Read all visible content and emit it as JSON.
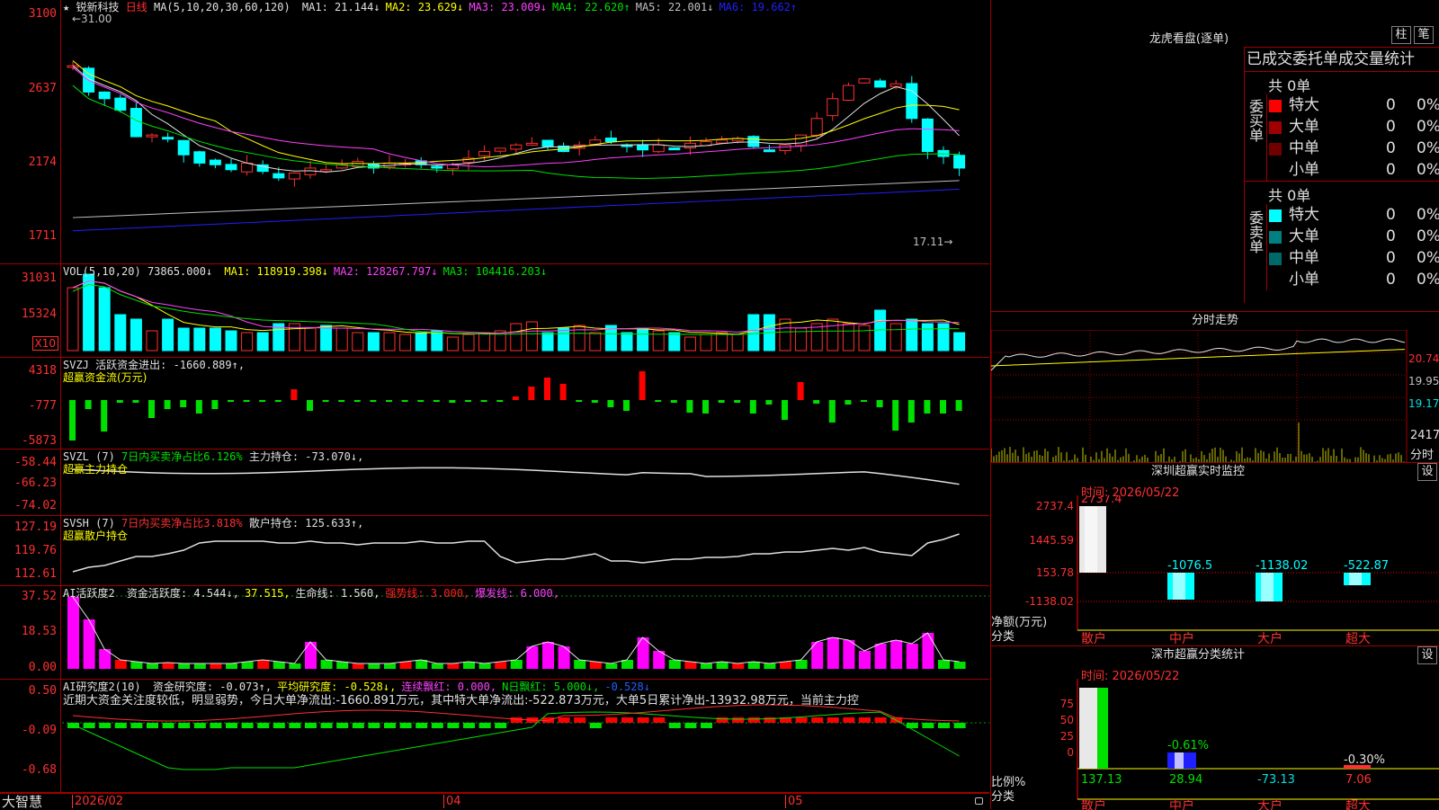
{
  "stock": {
    "star": "★",
    "name": "锐新科技",
    "period": "日线"
  },
  "main": {
    "ma_label": "MA(5,10,20,30,60,120)",
    "ma": [
      {
        "t": "MA1: 21.144↓",
        "c": "#e0e0e0"
      },
      {
        "t": "MA2: 23.629↓",
        "c": "#ffff00"
      },
      {
        "t": "MA3: 23.009↓",
        "c": "#ff40ff"
      },
      {
        "t": "MA4: 22.620↑",
        "c": "#00e000"
      },
      {
        "t": "MA5: 22.001↓",
        "c": "#c0c0c0"
      },
      {
        "t": "MA6: 19.662↑",
        "c": "#2020ff"
      }
    ],
    "y_labels": [
      "3100",
      "2637",
      "2174",
      "1711"
    ],
    "high_label": "←31.00",
    "low_label": "17.11→"
  },
  "vol": {
    "label": "VOL(5,10,20)",
    "val": "73865.000↓",
    "ma": [
      {
        "t": "MA1: 118919.398↓",
        "c": "#ffff00"
      },
      {
        "t": "MA2: 128267.797↓",
        "c": "#ff40ff"
      },
      {
        "t": "MA3: 104416.203↓",
        "c": "#00e000"
      }
    ],
    "y_labels": [
      "31031",
      "15324"
    ],
    "unit": "X10"
  },
  "svzj": {
    "label": "SVZJ",
    "text": "活跃资金进出: -1660.889↑,",
    "sub": "超赢资金流(万元)",
    "y_labels": [
      "4318",
      "-777",
      "-5873"
    ]
  },
  "svzl": {
    "label": "SVZL (7)",
    "red": "7日内买卖净占比6.126%",
    "text": "主力持仓: -73.070↓,",
    "sub": "超赢主力持仓",
    "y_labels": [
      "-58.44",
      "-66.23",
      "-74.02"
    ]
  },
  "svsh": {
    "label": "SVSH (7)",
    "red": "7日内买卖净占比3.818%",
    "text": "散户持仓: 125.633↑,",
    "sub": "超赢散户持仓",
    "y_labels": [
      "127.19",
      "119.76",
      "112.61"
    ]
  },
  "ai1": {
    "label": "AI活跃度2",
    "items": [
      {
        "t": "资金活跃度: 4.544↓,",
        "c": "#e0e0e0"
      },
      {
        "t": "37.515,",
        "c": "#ffff00"
      },
      {
        "t": "生命线: 1.560,",
        "c": "#e0e0e0"
      },
      {
        "t": "强势线: 3.000,",
        "c": "#ff2020"
      },
      {
        "t": "爆发线: 6.000,",
        "c": "#ff40ff"
      }
    ],
    "y_labels": [
      "37.52",
      "18.53",
      "0.00"
    ]
  },
  "ai2": {
    "label": "AI研究度2(10)",
    "items": [
      {
        "t": "资金研究度: -0.073↑,",
        "c": "#e0e0e0"
      },
      {
        "t": "平均研究度: -0.528↓,",
        "c": "#ffff00"
      },
      {
        "t": "连续飘红: 0.000,",
        "c": "#ff40ff"
      },
      {
        "t": "N日飘红: 5.000↓,",
        "c": "#00e000"
      },
      {
        "t": "-0.528↓",
        "c": "#2060ff"
      }
    ],
    "note": "近期大资金关注度较低，明显弱势，今日大单净流出:-1660.891万元，其中特大单净流出:-522.873万元，大单5日累计净出-13932.98万元，当前主力控",
    "y_labels": [
      "0.50",
      "-0.09",
      "-0.68"
    ]
  },
  "dates": {
    "d1": "2026/02",
    "d2": "04",
    "d3": "05"
  },
  "brand": "大智慧",
  "lhb": {
    "title": "龙虎看盘(逐单)",
    "btn_zhu": "柱",
    "btn_bi": "笔",
    "header": "已成交委托单成交量统计",
    "buy_total": "共 0单",
    "sell_total": "共 0单",
    "buy_label": "委买单",
    "sell_label": "委卖单",
    "buy_rows": [
      {
        "name": "特大",
        "n": "0",
        "p": "0%",
        "c": "#ff0000"
      },
      {
        "name": "大单",
        "n": "0",
        "p": "0%",
        "c": "#a00000"
      },
      {
        "name": "中单",
        "n": "0",
        "p": "0%",
        "c": "#700000"
      },
      {
        "name": "小单",
        "n": "0",
        "p": "0%",
        "c": "#000000"
      }
    ],
    "sell_rows": [
      {
        "name": "特大",
        "n": "0",
        "p": "0%",
        "c": "#00ffff"
      },
      {
        "name": "大单",
        "n": "0",
        "p": "0%",
        "c": "#008080"
      },
      {
        "name": "中单",
        "n": "0",
        "p": "0%",
        "c": "#006868"
      },
      {
        "name": "小单",
        "n": "0",
        "p": "0%",
        "c": "#000000"
      }
    ]
  },
  "fenshi": {
    "title": "分时走势",
    "y1": "20.74",
    "y2": "19.95",
    "y3": "19.17",
    "vol": "2417",
    "unit": "分时"
  },
  "monitor": {
    "title": "深圳超赢实时监控",
    "btn": "设",
    "time": "时间: 2026/05/22",
    "y_labels": [
      "2737.4",
      "1445.59",
      "153.78",
      "-1138.02"
    ],
    "ylabel1": "净额(万元)",
    "ylabel2": "分类",
    "cats": [
      "散户",
      "中户",
      "大户",
      "超大"
    ],
    "values": [
      "2737.4",
      "-1076.5",
      "-1138.02",
      "-522.87"
    ]
  },
  "classify": {
    "title": "深市超赢分类统计",
    "btn": "设",
    "time": "时间: 2026/05/22",
    "y_labels": [
      "75",
      "50",
      "25",
      "0"
    ],
    "ylabel1": "比例%",
    "ylabel2": "分类",
    "cats": [
      "散户",
      "中户",
      "大户",
      "超大"
    ],
    "values": [
      "137.13",
      "28.94",
      "-73.13",
      "7.06"
    ],
    "top_labels": [
      "-0.61%",
      "-0.30%"
    ]
  }
}
